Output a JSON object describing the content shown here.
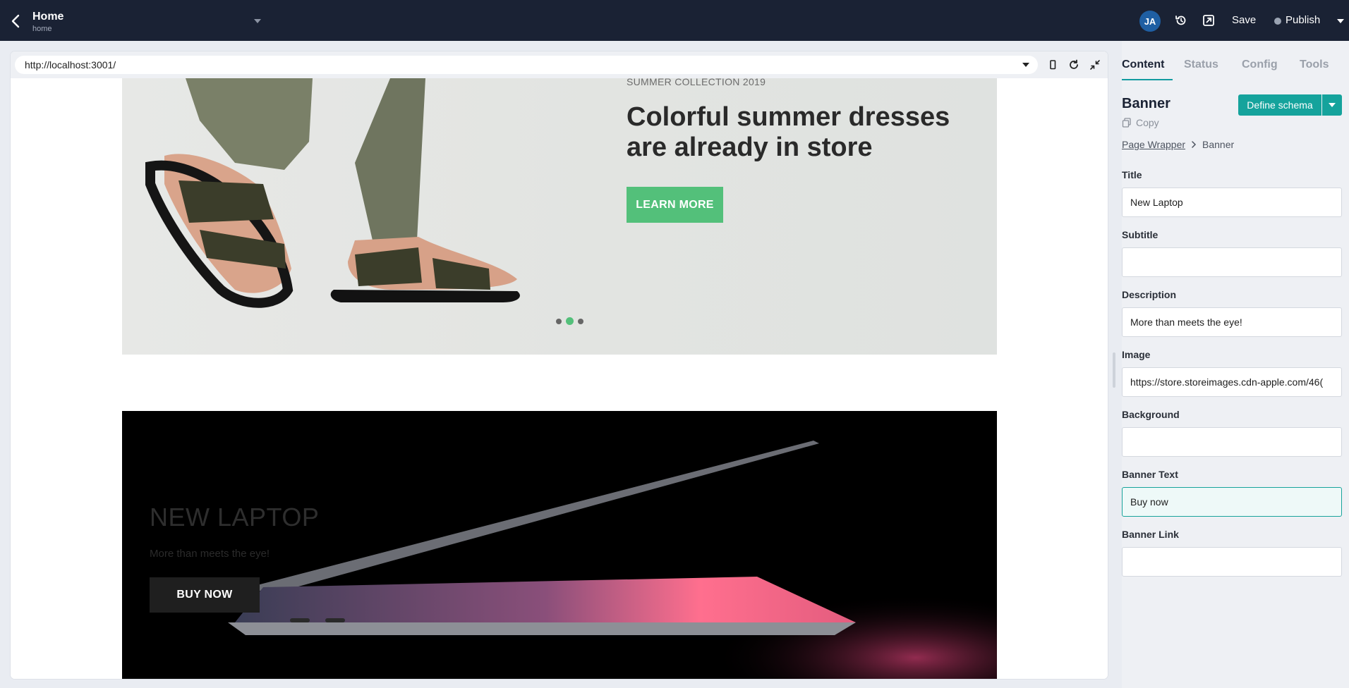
{
  "topbar": {
    "page_title": "Home",
    "page_slug": "home",
    "avatar_initials": "JA",
    "save_label": "Save",
    "publish_label": "Publish"
  },
  "preview": {
    "url": "http://localhost:3001/",
    "banner1": {
      "subtitle": "SUMMER COLLECTION 2019",
      "title": "Colorful summer dresses are already in store",
      "button_label": "LEARN MORE",
      "accent_color": "#53c07a",
      "slides": 3,
      "active_slide": 2
    },
    "banner2": {
      "title": "NEW LAPTOP",
      "description": "More than meets the eye!",
      "button_label": "BUY NOW"
    }
  },
  "panel": {
    "tabs": [
      {
        "label": "Content",
        "active": true
      },
      {
        "label": "Status",
        "active": false
      },
      {
        "label": "Config",
        "active": false
      },
      {
        "label": "Tools",
        "active": false
      }
    ],
    "component_title": "Banner",
    "copy_label": "Copy",
    "define_schema_label": "Define schema",
    "breadcrumb": {
      "parent": "Page Wrapper",
      "current": "Banner"
    },
    "accent_color": "#15a39c",
    "fields": [
      {
        "label": "Title",
        "value": "New Laptop"
      },
      {
        "label": "Subtitle",
        "value": ""
      },
      {
        "label": "Description",
        "value": "More than meets the eye!"
      },
      {
        "label": "Image",
        "value": "https://store.storeimages.cdn-apple.com/46("
      },
      {
        "label": "Background",
        "value": ""
      },
      {
        "label": "Banner Text",
        "value": "Buy now",
        "focused": true
      },
      {
        "label": "Banner Link",
        "value": ""
      }
    ]
  }
}
